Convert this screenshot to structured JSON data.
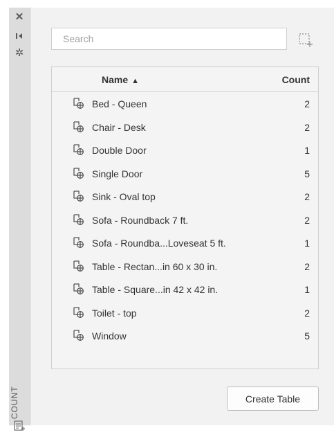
{
  "sidebar": {
    "title": "COUNT",
    "icons": [
      "close-icon",
      "pin-icon",
      "gear-icon",
      "table-icon"
    ]
  },
  "search": {
    "placeholder": "Search",
    "value": ""
  },
  "table": {
    "headers": {
      "name": "Name",
      "count": "Count",
      "sort": "ascending"
    },
    "rows": [
      {
        "name": "Bed - Queen",
        "count": "2"
      },
      {
        "name": "Chair - Desk",
        "count": "2"
      },
      {
        "name": "Double Door",
        "count": "1"
      },
      {
        "name": "Single Door",
        "count": "5"
      },
      {
        "name": "Sink - Oval top",
        "count": "2"
      },
      {
        "name": "Sofa - Roundback 7 ft.",
        "count": "2"
      },
      {
        "name": "Sofa - Roundba...Loveseat 5 ft.",
        "count": "1"
      },
      {
        "name": "Table - Rectan...in 60 x 30 in.",
        "count": "2"
      },
      {
        "name": "Table - Square...in 42 x 42 in.",
        "count": "1"
      },
      {
        "name": "Toilet - top",
        "count": "2"
      },
      {
        "name": "Window",
        "count": "5"
      }
    ]
  },
  "actions": {
    "create_table": "Create Table"
  },
  "colors": {
    "panel_bg": "#f2f2f2",
    "sidebar_bg": "#dcdcdc",
    "icon": "#555555"
  }
}
